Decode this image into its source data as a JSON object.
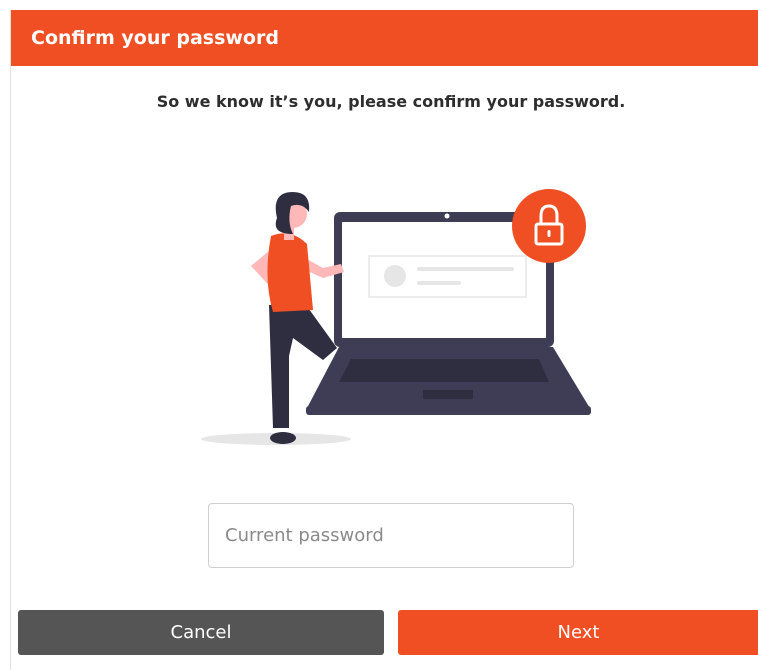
{
  "dialog": {
    "title": "Confirm your password",
    "subtitle": "So we know it’s you, please confirm your password."
  },
  "form": {
    "password_placeholder": "Current password",
    "password_value": ""
  },
  "buttons": {
    "cancel_label": "Cancel",
    "next_label": "Next"
  },
  "icons": {
    "illustration": "woman-leaning-on-laptop-illustration",
    "lock": "lock-icon"
  },
  "colors": {
    "accent": "#f04e23",
    "cancel": "#555555",
    "illustration_dark": "#3f3d56"
  }
}
